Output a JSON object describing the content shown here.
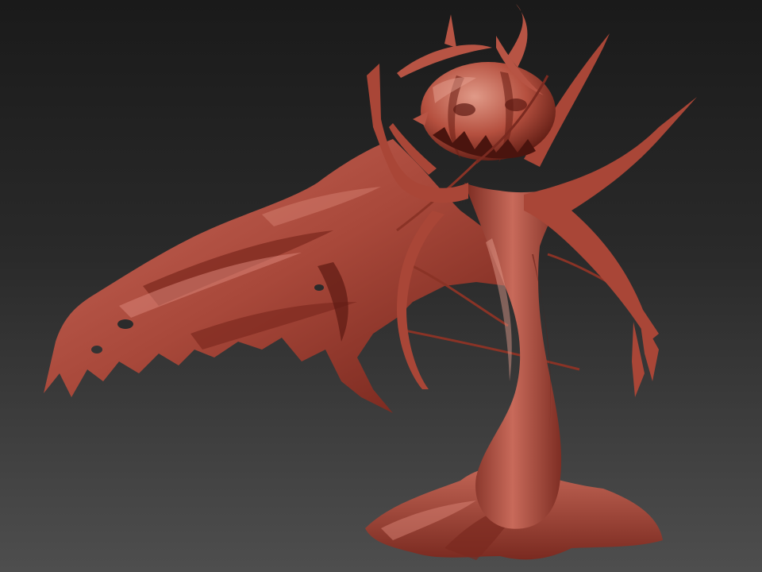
{
  "scene": {
    "subject_icon": "sculpt-figure",
    "colors": {
      "background_top": "#1a1a1a",
      "background_bottom": "#4e4e4e",
      "clay_light": "#d88a7a",
      "clay_mid": "#b24e3e",
      "clay_dark": "#6e2118",
      "clay_deep": "#3f0f0a"
    }
  }
}
